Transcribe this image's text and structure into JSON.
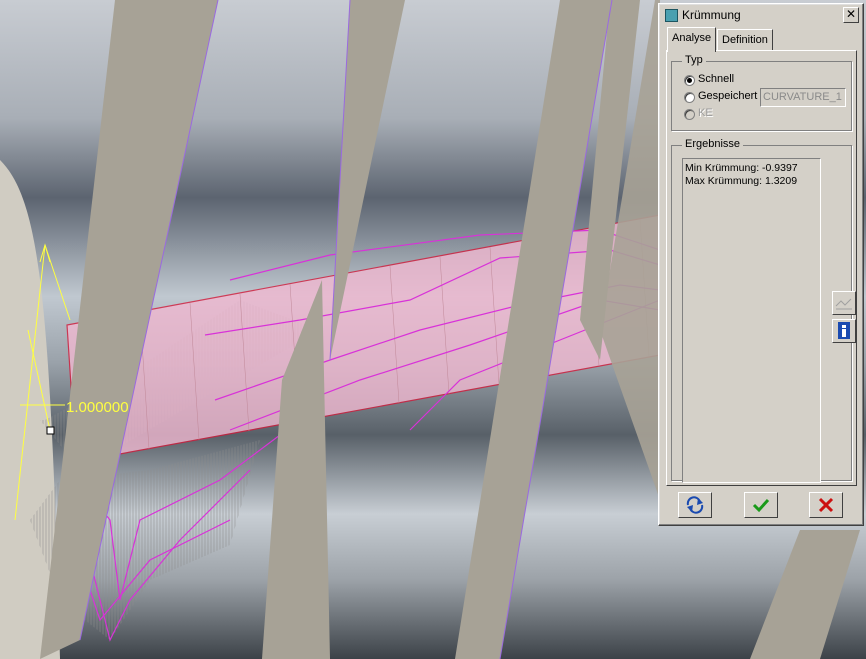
{
  "viewport": {
    "dimension_label": "1.000000",
    "colors": {
      "background": "#8a9096",
      "surface_fill": "#f0b8d0",
      "surface_edge": "#d21a3a",
      "curvature_comb": "#d832d8",
      "comb_hatch": "#8c8c8c",
      "dimension": "#ffff40",
      "rib": "#a7a296"
    }
  },
  "dialog": {
    "title": "Krümmung",
    "close_glyph": "✕",
    "tabs": [
      {
        "label": "Analyse",
        "active": true
      },
      {
        "label": "Definition",
        "active": false
      }
    ],
    "type_group": {
      "label": "Typ",
      "options": [
        {
          "label": "Schnell",
          "checked": true,
          "enabled": true
        },
        {
          "label": "Gespeichert",
          "checked": false,
          "enabled": true
        },
        {
          "label": "KE",
          "checked": false,
          "enabled": false
        }
      ],
      "saved_name": "CURVATURE_1"
    },
    "results_group": {
      "label": "Ergebnisse",
      "lines": [
        "Min Krümmung: -0.9397",
        "Max Krümmung: 1.3209"
      ]
    },
    "side_buttons": [
      "graph-icon",
      "info-icon"
    ],
    "footer_buttons": [
      "repeat-icon",
      "ok-checkmark-icon",
      "cancel-x-icon"
    ],
    "colors": {
      "face": "#d4d0c8",
      "ok": "#1a9a1a",
      "cancel": "#cc1010",
      "icon_blue": "#1a4ab0"
    }
  }
}
